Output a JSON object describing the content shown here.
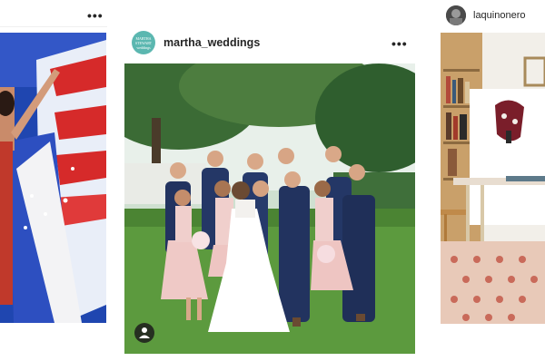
{
  "feed": {
    "left_post": {
      "more_label": "•••",
      "photo_alt": "flag dress performer"
    },
    "center_post": {
      "username": "martha_weddings",
      "avatar_text": "MARTHA STEWART weddings",
      "more_label": "•••",
      "colors": {
        "avatar_bg": "#5bb7b0"
      }
    },
    "right_post": {
      "username": "laquinonero",
      "more_label": "•••"
    }
  }
}
